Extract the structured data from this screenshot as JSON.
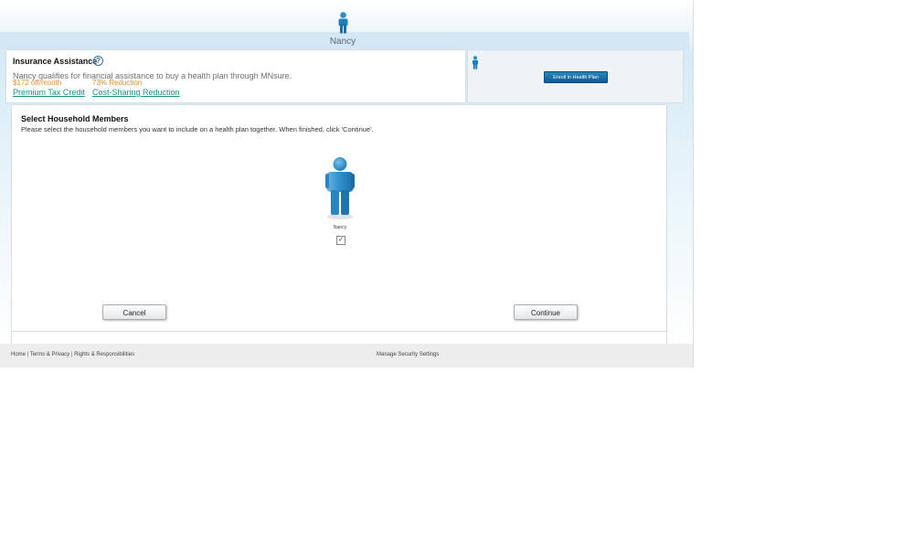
{
  "header": {
    "member_name": "Nancy",
    "person_icon": "person-icon"
  },
  "insurance_assistance": {
    "title": "Insurance Assistance",
    "help_symbol": "?",
    "description": "Nancy qualifies for financial assistance to buy a health plan through MNsure.",
    "premium_amount": "$172 off/month",
    "cost_sharing_amount": "73% Reduction",
    "premium_link": "Premium Tax Credit",
    "cost_sharing_link": "Cost-Sharing Reduction"
  },
  "enroll_panel": {
    "person_icon": "person-icon",
    "enroll_button": "Enroll in Health Plan"
  },
  "household": {
    "title": "Select Household Members",
    "instructions": "Please select the household members you want to include on a health plan together. When finished, click 'Continue'.",
    "members": [
      {
        "name": "Nancy",
        "checked": true,
        "check_symbol": "✓"
      }
    ],
    "cancel_button": "Cancel",
    "continue_button": "Continue"
  },
  "footer": {
    "home": "Home",
    "separator": "|",
    "terms": "Terms & Privacy",
    "rights": "Rights & Responsibilities",
    "security": "Manage Security Settings"
  },
  "colors": {
    "header_band": "#d3e8f4",
    "accent_orange": "#e08b25",
    "link_teal": "#138f84",
    "enroll_button": "#0b5d96",
    "person_blue": "#1f80bd"
  }
}
